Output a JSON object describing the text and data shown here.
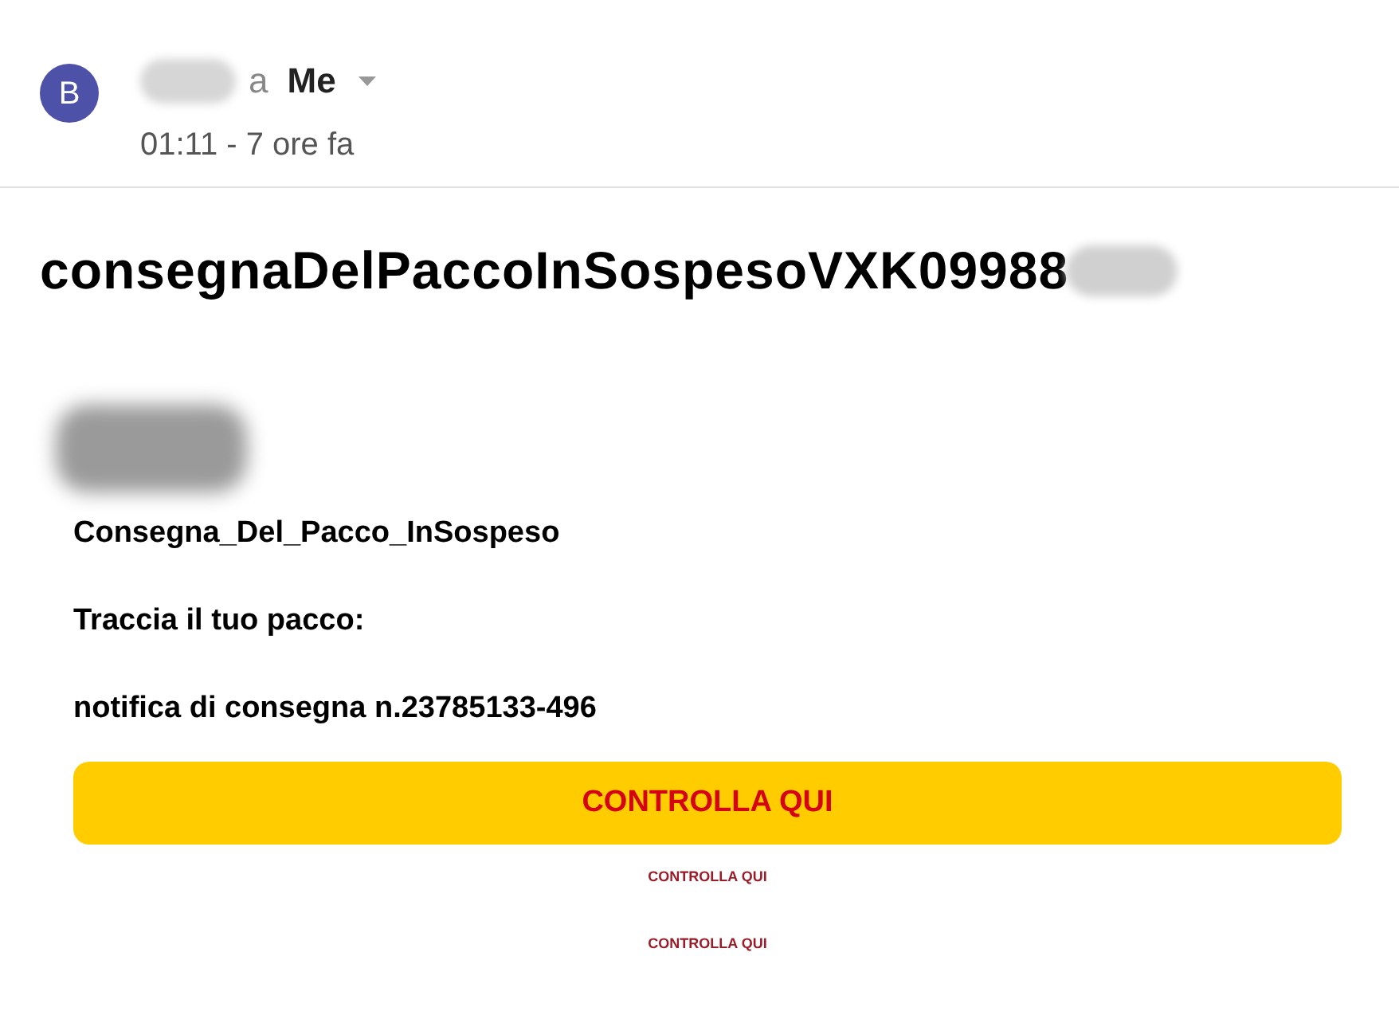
{
  "header": {
    "avatar_letter": "B",
    "connector": "a",
    "recipient": "Me",
    "time": "01:11 - 7 ore fa"
  },
  "subject": "consegnaDelPaccoInSospesoVXK09988",
  "body": {
    "lines": [
      "Consegna_Del_Pacco_InSospeso",
      "Traccia il tuo pacco:",
      "notifica di consegna n.23785133-496"
    ],
    "button": "CONTROLLA QUI",
    "links": [
      "CONTROLLA QUI",
      "CONTROLLA QUI"
    ]
  }
}
